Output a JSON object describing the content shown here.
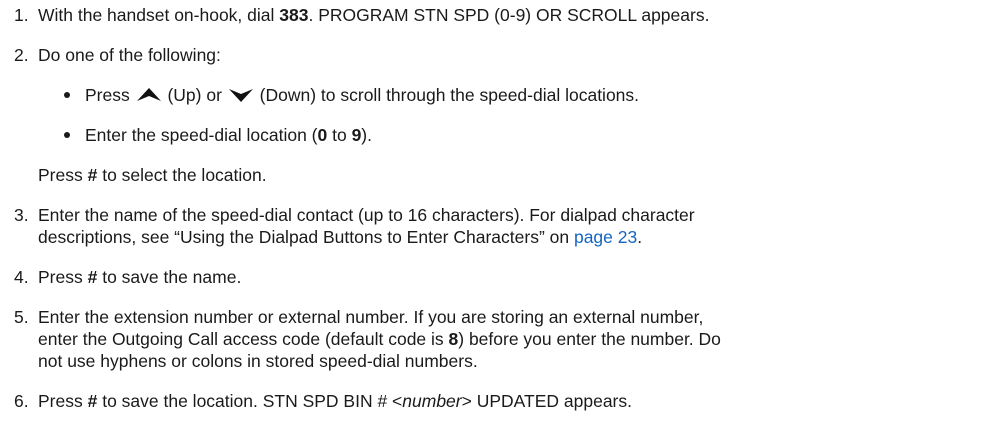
{
  "steps": [
    {
      "num": "1.",
      "a": "With the handset on-hook, dial ",
      "b": "383",
      "c": ". PROGRAM STN SPD (0-9) OR SCROLL appears."
    },
    {
      "num": "2.",
      "a": "Do one of the following:"
    },
    {
      "num": "3.",
      "line1": "Enter the name of the speed-dial contact (up to 16 characters). For dialpad character",
      "line2a": "descriptions, see “Using the Dialpad Buttons to Enter Characters” on ",
      "link": "page 23",
      "line2b": "."
    },
    {
      "num": "4.",
      "a": "Press ",
      "b": "#",
      "c": " to save the name."
    },
    {
      "num": "5.",
      "line1": "Enter the extension number or external number. If you are storing an external number,",
      "line2a": "enter the Outgoing Call access code (default code is ",
      "line2b": "8",
      "line2c": ") before you enter the number. Do",
      "line3": "not use hyphens or colons in stored speed-dial numbers."
    },
    {
      "num": "6.",
      "a": "Press ",
      "b": "#",
      "c": " to save the location. STN SPD BIN # <",
      "d": "number",
      "e": "> UPDATED appears."
    }
  ],
  "bullets": [
    {
      "a": "Press ",
      "up_icon": "up-arrow-icon",
      "b": " (Up) or ",
      "down_icon": "down-arrow-icon",
      "c": " (Down) to scroll through the speed-dial locations."
    },
    {
      "a": "Enter the speed-dial location (",
      "b": "0",
      "c": " to ",
      "d": "9",
      "e": ")."
    }
  ],
  "after_bullets": {
    "a": "Press ",
    "b": "#",
    "c": " to select the location."
  },
  "colors": {
    "text": "#1a1a1a",
    "link": "#1565c0"
  }
}
